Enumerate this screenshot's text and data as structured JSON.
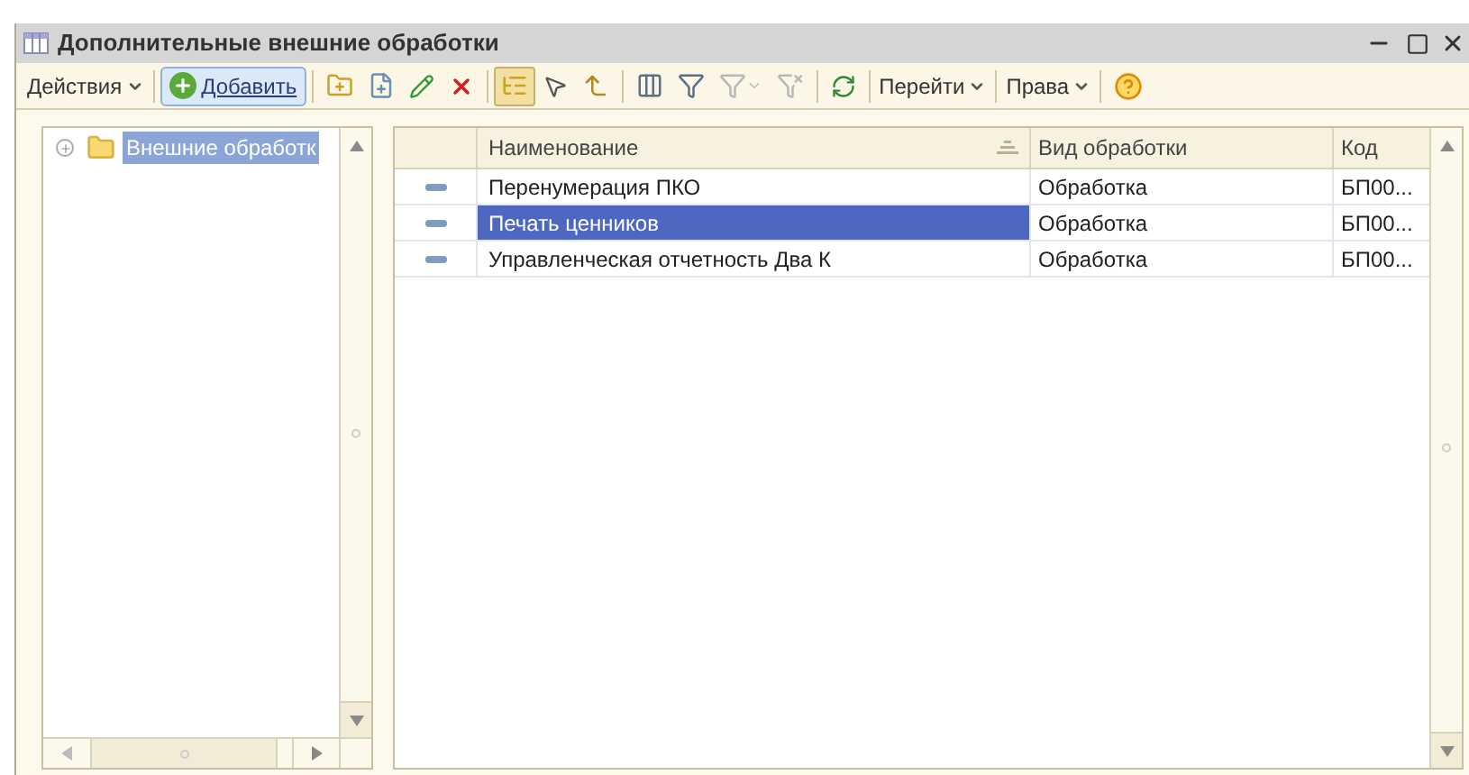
{
  "window": {
    "title": "Дополнительные внешние обработки"
  },
  "toolbar": [
    {
      "kind": "menu",
      "label": "Действия"
    },
    {
      "kind": "separator"
    },
    {
      "kind": "add",
      "label": "Добавить"
    },
    {
      "kind": "separator"
    },
    {
      "kind": "folder-add",
      "pressed": false,
      "disabled": false
    },
    {
      "kind": "copy",
      "pressed": false,
      "disabled": false
    },
    {
      "kind": "edit",
      "pressed": false,
      "disabled": false
    },
    {
      "kind": "delete",
      "pressed": false,
      "disabled": false
    },
    {
      "kind": "separator"
    },
    {
      "kind": "tree-mode",
      "pressed": true,
      "disabled": false
    },
    {
      "kind": "choose",
      "pressed": false,
      "disabled": false
    },
    {
      "kind": "up-level",
      "pressed": false,
      "disabled": false
    },
    {
      "kind": "separator"
    },
    {
      "kind": "filter-set",
      "pressed": false,
      "disabled": false
    },
    {
      "kind": "filter-edit",
      "pressed": false,
      "disabled": false
    },
    {
      "kind": "filter-menu",
      "pressed": false,
      "disabled": true
    },
    {
      "kind": "filter-clear",
      "pressed": false,
      "disabled": true
    },
    {
      "kind": "separator"
    },
    {
      "kind": "refresh",
      "pressed": false,
      "disabled": false
    },
    {
      "kind": "separator"
    },
    {
      "kind": "menu",
      "label": "Перейти"
    },
    {
      "kind": "separator"
    },
    {
      "kind": "menu",
      "label": "Права"
    },
    {
      "kind": "separator"
    },
    {
      "kind": "help",
      "pressed": false,
      "disabled": false
    }
  ],
  "tree": {
    "items": [
      {
        "label": "Внешние обработк",
        "expanded": false,
        "selected": true
      }
    ]
  },
  "table": {
    "columns": [
      "Наименование",
      "Вид обработки",
      "Код"
    ],
    "rows": [
      {
        "cells": [
          "Перенумерация ПКО",
          "Обработка",
          "БП00..."
        ],
        "selected": false
      },
      {
        "cells": [
          "Печать ценников",
          "Обработка",
          "БП00..."
        ],
        "selected": true
      },
      {
        "cells": [
          "Управленческая отчетность Два К",
          "Обработка",
          "БП00..."
        ],
        "selected": false
      }
    ]
  }
}
